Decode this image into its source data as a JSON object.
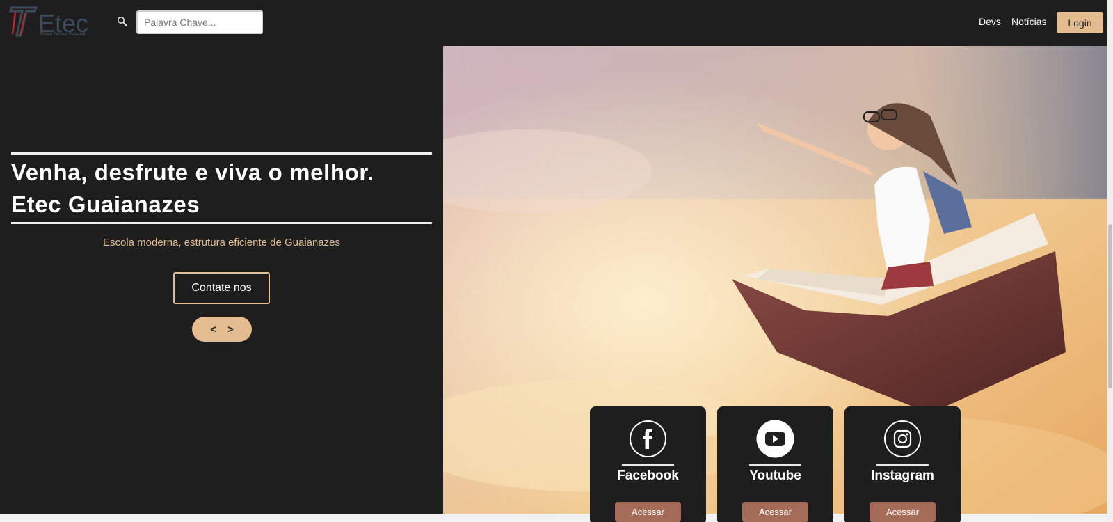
{
  "header": {
    "logo_text": "Etec",
    "logo_subtext": "Escola Técnica Estadual",
    "search": {
      "placeholder": "Palavra Chave...",
      "value": ""
    },
    "nav": [
      {
        "label": "Devs"
      },
      {
        "label": "Notícias"
      }
    ],
    "login_label": "Login"
  },
  "hero": {
    "headline_line1": "Venha, desfrute e viva o melhor.",
    "headline_line2": "Etec Guaianazes",
    "subtitle": "Escola moderna, estrutura eficiente de Guaianazes",
    "contact_label": "Contate nos",
    "prev_label": "<",
    "next_label": ">"
  },
  "social_cards": [
    {
      "title": "Facebook",
      "button": "Acessar",
      "icon": "facebook-icon"
    },
    {
      "title": "Youtube",
      "button": "Acessar",
      "icon": "youtube-icon"
    },
    {
      "title": "Instagram",
      "button": "Acessar",
      "icon": "instagram-icon"
    }
  ],
  "colors": {
    "background_dark": "#1e1e1e",
    "accent": "#e3bd8f",
    "card_button": "#a46b58",
    "logo": "#3c4a5c"
  }
}
